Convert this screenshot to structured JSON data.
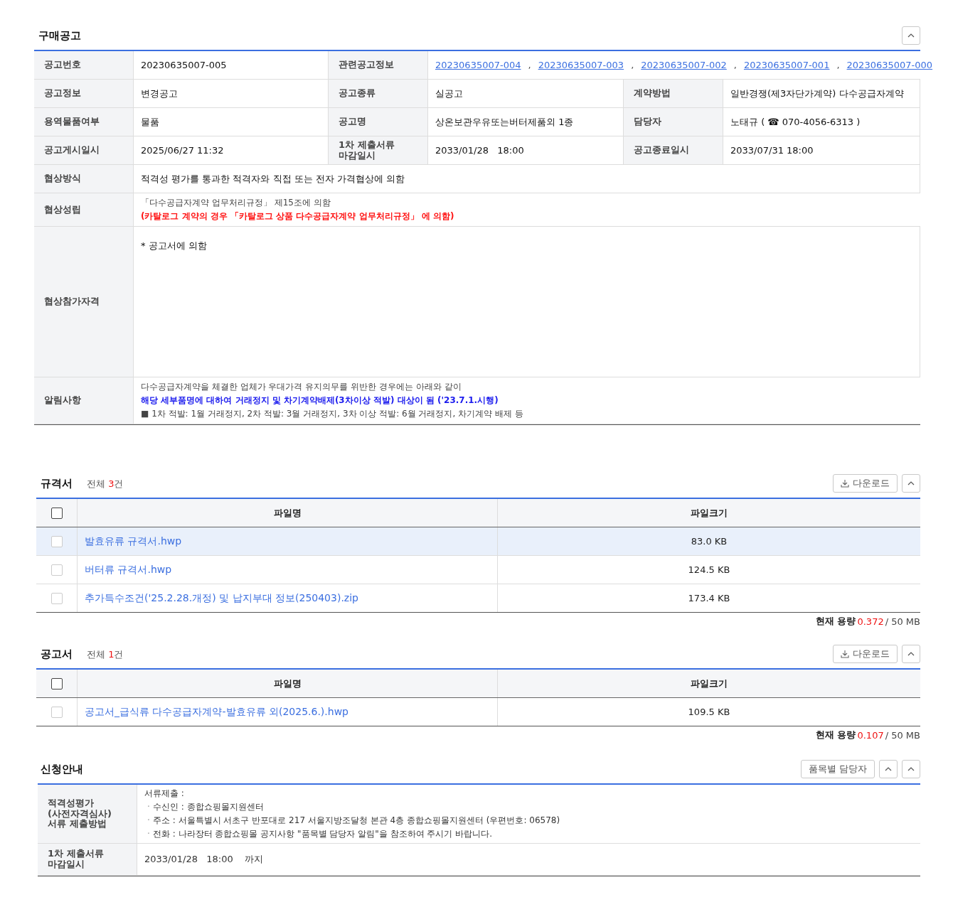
{
  "notice": {
    "title": "구매공고",
    "rows": [
      {
        "fields": [
          {
            "label": "공고번호",
            "kind": "text",
            "value": "20230635007-005"
          },
          {
            "label": "관련공고정보",
            "kind": "links",
            "links": [
              "20230635007-004",
              "20230635007-003",
              "20230635007-002",
              "20230635007-001",
              "20230635007-000"
            ],
            "separator": ","
          }
        ]
      },
      {
        "fields": [
          {
            "label": "공고정보",
            "kind": "text",
            "value": "변경공고"
          },
          {
            "label": "공고종류",
            "kind": "text",
            "value": "실공고"
          },
          {
            "label": "계약방법",
            "kind": "text",
            "value": "일반경쟁(제3자단가계약) 다수공급자계약"
          }
        ]
      },
      {
        "fields": [
          {
            "label": "용역물품여부",
            "kind": "text",
            "value": "물품"
          },
          {
            "label": "공고명",
            "kind": "text",
            "value": "상온보관우유또는버터제품외 1종"
          },
          {
            "label": "담당자",
            "kind": "text",
            "value": "노태규 ( ☎ 070-4056-6313 )"
          }
        ]
      },
      {
        "fields": [
          {
            "label": "공고게시일시",
            "kind": "text",
            "value": "2025/06/27 11:32"
          },
          {
            "label": "1차 제출서류\n마감일시",
            "kind": "text",
            "value": "2033/01/28   18:00"
          },
          {
            "label": "공고종료일시",
            "kind": "text",
            "value": "2033/07/31 18:00"
          }
        ]
      },
      {
        "fields": [
          {
            "label": "협상방식",
            "kind": "text",
            "value": "적격성 평가를 통과한 적격자와 직접 또는 전자 가격협상에 의함"
          }
        ]
      },
      {
        "fields": [
          {
            "label": "협상성립",
            "kind": "lines",
            "lines": [
              {
                "text": "「다수공급자계약 업무처리규정」 제15조에 의함",
                "color": "#444444",
                "bold": false
              },
              {
                "text": "(카탈로그 계약의 경우 「카탈로그 상품 다수공급자계약 업무처리규정」 에 의함)",
                "color": "#ff1010",
                "bold": true
              }
            ]
          }
        ]
      },
      {
        "fields": [
          {
            "label": "협상참가자격",
            "kind": "block",
            "value": "* 공고서에 의함"
          }
        ]
      },
      {
        "fields": [
          {
            "label": "알림사항",
            "kind": "lines",
            "lines": [
              {
                "text": "다수공급자계약을 체결한 업체가 우대가격 유지의무를 위반한 경우에는 아래와 같이",
                "color": "#444444",
                "bold": false
              },
              {
                "text": "해당 세부품명에 대하여 거래정지 및 차기계약배제(3차이상 적발) 대상이 됨 ('23.7.1.시행)",
                "color": "#1a1aee",
                "bold": true
              },
              {
                "text": "■ 1차 적발: 1월 거래정지, 2차 적발: 3월 거래정지, 3차 이상 적발: 6월 거래정지, 차기계약 배제 등",
                "color": "#444444",
                "bold": false
              }
            ]
          }
        ]
      }
    ]
  },
  "file_sections": [
    {
      "title": "규격서",
      "total_label": "전체",
      "count": "3",
      "count_unit": "건",
      "download_label": "다운로드",
      "columns": [
        "파일명",
        "파일크기"
      ],
      "all_checked": false,
      "files": [
        {
          "name": "발효유류 규격서.hwp",
          "size": "83.0 KB",
          "checked": false,
          "selected": true
        },
        {
          "name": "버터류 규격서.hwp",
          "size": "124.5 KB",
          "checked": false,
          "selected": false
        },
        {
          "name": "추가특수조건('25.2.28.개정) 및 납지부대 정보(250403).zip",
          "size": "173.4 KB",
          "checked": false,
          "selected": false
        }
      ],
      "usage_label": "현재 용량",
      "usage": "0.372",
      "usage_limit": "/ 50 MB"
    },
    {
      "title": "공고서",
      "total_label": "전체",
      "count": "1",
      "count_unit": "건",
      "download_label": "다운로드",
      "columns": [
        "파일명",
        "파일크기"
      ],
      "all_checked": false,
      "files": [
        {
          "name": "공고서_급식류 다수공급자계약-발효유류 외(2025.6.).hwp",
          "size": "109.5 KB",
          "checked": false,
          "selected": false
        }
      ],
      "usage_label": "현재 용량",
      "usage": "0.107",
      "usage_limit": "/ 50 MB"
    }
  ],
  "application": {
    "title": "신청안내",
    "button": "품목별 담당자",
    "rows": [
      {
        "label": "적격성평가\n(사전자격심사)\n서류 제출방법",
        "lines": [
          "서류제출 :",
          "ㆍ수신인 : 종합쇼핑몰지원센터",
          "ㆍ주소 : 서울특별시 서초구 반포대로 217 서울지방조달청 본관 4층 종합쇼핑몰지원센터 (우편번호: 06578)",
          "ㆍ전화 : 나라장터 종합쇼핑몰 공지사항 \"품목별 담당자 알림\"을 참조하여 주시기 바랍니다."
        ]
      },
      {
        "label": "1차 제출서류\n마감일시",
        "lines": [
          "2033/01/28   18:00    까지"
        ]
      }
    ]
  }
}
